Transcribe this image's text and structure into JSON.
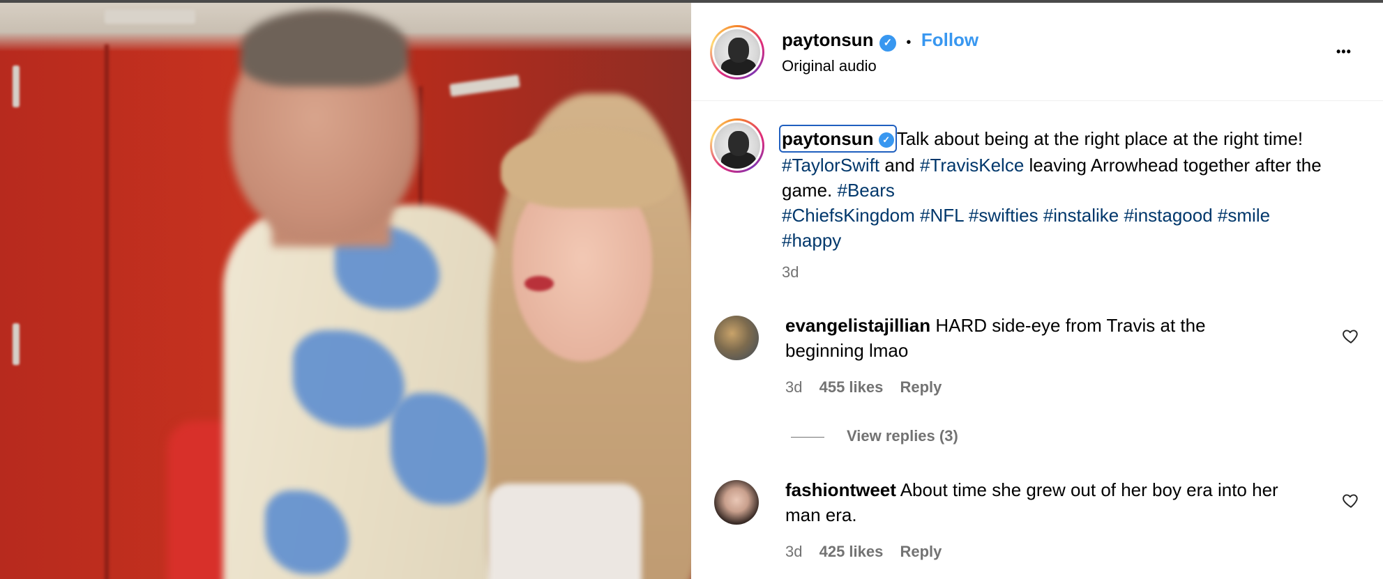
{
  "header": {
    "username": "paytonsun",
    "dot": "•",
    "follow_label": "Follow",
    "subtitle": "Original audio",
    "more_label": "•••"
  },
  "caption": {
    "username": "paytonsun",
    "text_1": "Talk about being at the right place at the right time! ",
    "tag_1": "#TaylorSwift",
    "text_2": " and ",
    "tag_2": "#TravisKelce",
    "text_3": " leaving Arrowhead together after the game. ",
    "tag_3": "#Bears",
    "tags_rest": [
      "#ChiefsKingdom",
      "#NFL",
      "#swifties",
      "#instalike",
      "#instagood",
      "#smile",
      "#happy"
    ],
    "time": "3d"
  },
  "comments": [
    {
      "username": "evangelistajillian",
      "text": "HARD side-eye from Travis at the beginning lmao",
      "time": "3d",
      "likes": "455 likes",
      "reply": "Reply",
      "view_replies": "View replies (3)"
    },
    {
      "username": "fashiontweet",
      "text": "About time she grew out of her boy era into her man era.",
      "time": "3d",
      "likes": "425 likes",
      "reply": "Reply"
    }
  ],
  "icons": {
    "verified": "verified-badge-icon",
    "heart": "heart-outline-icon",
    "more": "more-horizontal-icon"
  },
  "colors": {
    "link_blue": "#3897f0",
    "hashtag": "#00376b",
    "muted": "#737373"
  }
}
